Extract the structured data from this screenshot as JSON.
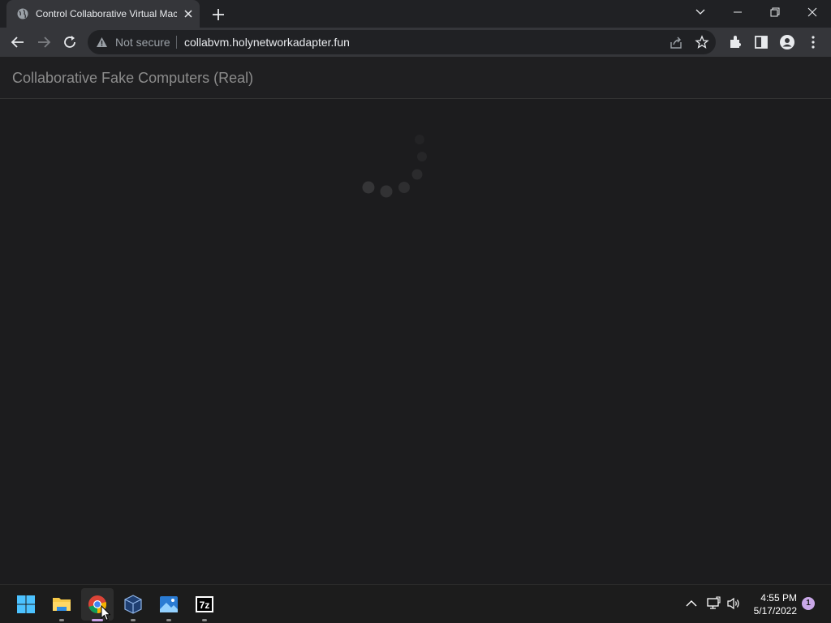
{
  "browser": {
    "tab": {
      "title": "Control Collaborative Virtual Machines",
      "favicon": "globe-icon"
    },
    "new_tab": "plus-icon",
    "window_controls": [
      "chevron-down-icon",
      "minimize-icon",
      "restore-icon",
      "close-icon"
    ],
    "toolbar": {
      "back": "arrow-left-icon",
      "forward": "arrow-right-icon",
      "reload": "reload-icon",
      "security_warning": "Not secure",
      "url": "collabvm.holynetworkadapter.fun",
      "right_icons": [
        "share-icon",
        "star-icon",
        "extensions-icon",
        "side-panel-icon",
        "profile-icon",
        "menu-icon"
      ]
    }
  },
  "page": {
    "brand": "Collaborative Fake Computers (Real)",
    "loading": true
  },
  "taskbar": {
    "apps": [
      {
        "name": "start",
        "icon": "windows-icon",
        "active": false
      },
      {
        "name": "file-explorer",
        "icon": "folder-icon",
        "active": false
      },
      {
        "name": "chrome",
        "icon": "chrome-icon",
        "active": true
      },
      {
        "name": "virtualbox",
        "icon": "virtualbox-icon",
        "active": false
      },
      {
        "name": "photos",
        "icon": "photos-icon",
        "active": false
      },
      {
        "name": "7-zip",
        "icon": "7zip-icon",
        "active": false
      }
    ],
    "seven_zip_label": "7z",
    "tray": [
      "chevron-up-icon",
      "network-icon",
      "volume-icon"
    ],
    "time": "4:55 PM",
    "date": "5/17/2022",
    "notification_count": "1"
  },
  "colors": {
    "tab_bar": "#202124",
    "toolbar": "#35363a",
    "page_background": "#1c1c1e",
    "taskbar": "#1c1c1c",
    "accent": "#c7a2e6"
  }
}
